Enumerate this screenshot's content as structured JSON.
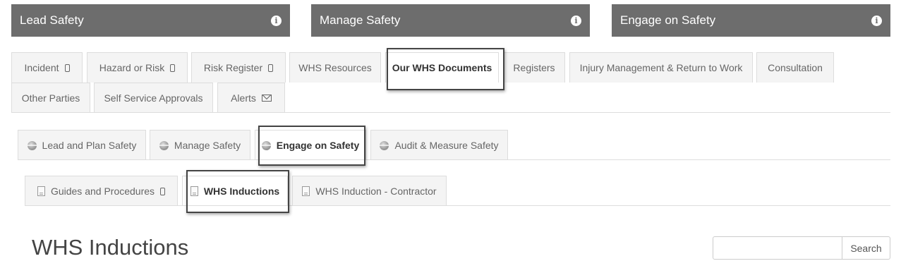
{
  "top_bars": [
    {
      "label": "Lead Safety"
    },
    {
      "label": "Manage Safety"
    },
    {
      "label": "Engage on Safety"
    }
  ],
  "info_icon_glyph": "i",
  "primary_tabs": [
    {
      "label": "Incident",
      "icon": "mobile-icon"
    },
    {
      "label": "Hazard or Risk",
      "icon": "mobile-icon"
    },
    {
      "label": "Risk Register",
      "icon": "mobile-icon"
    },
    {
      "label": "WHS Resources"
    },
    {
      "label": "Our WHS Documents",
      "active": true
    },
    {
      "label": "Registers"
    },
    {
      "label": "Injury Management & Return to Work"
    },
    {
      "label": "Consultation"
    },
    {
      "label": "Other Parties"
    },
    {
      "label": "Self Service Approvals"
    },
    {
      "label": "Alerts",
      "icon": "mail-icon"
    }
  ],
  "secondary_tabs": [
    {
      "label": "Lead and Plan Safety",
      "icon": "globe-icon"
    },
    {
      "label": "Manage Safety",
      "icon": "globe-icon"
    },
    {
      "label": "Engage on Safety",
      "icon": "globe-icon",
      "active": true
    },
    {
      "label": "Audit & Measure Safety",
      "icon": "globe-icon"
    }
  ],
  "tertiary_tabs": [
    {
      "label": "Guides and Procedures",
      "icon": "doc-icon",
      "trailing_icon": "mobile-icon"
    },
    {
      "label": "WHS Inductions",
      "icon": "doc-icon",
      "active": true
    },
    {
      "label": "WHS Induction - Contractor",
      "icon": "doc-icon"
    }
  ],
  "page": {
    "title": "WHS Inductions"
  },
  "search": {
    "button_label": "Search",
    "placeholder": ""
  }
}
